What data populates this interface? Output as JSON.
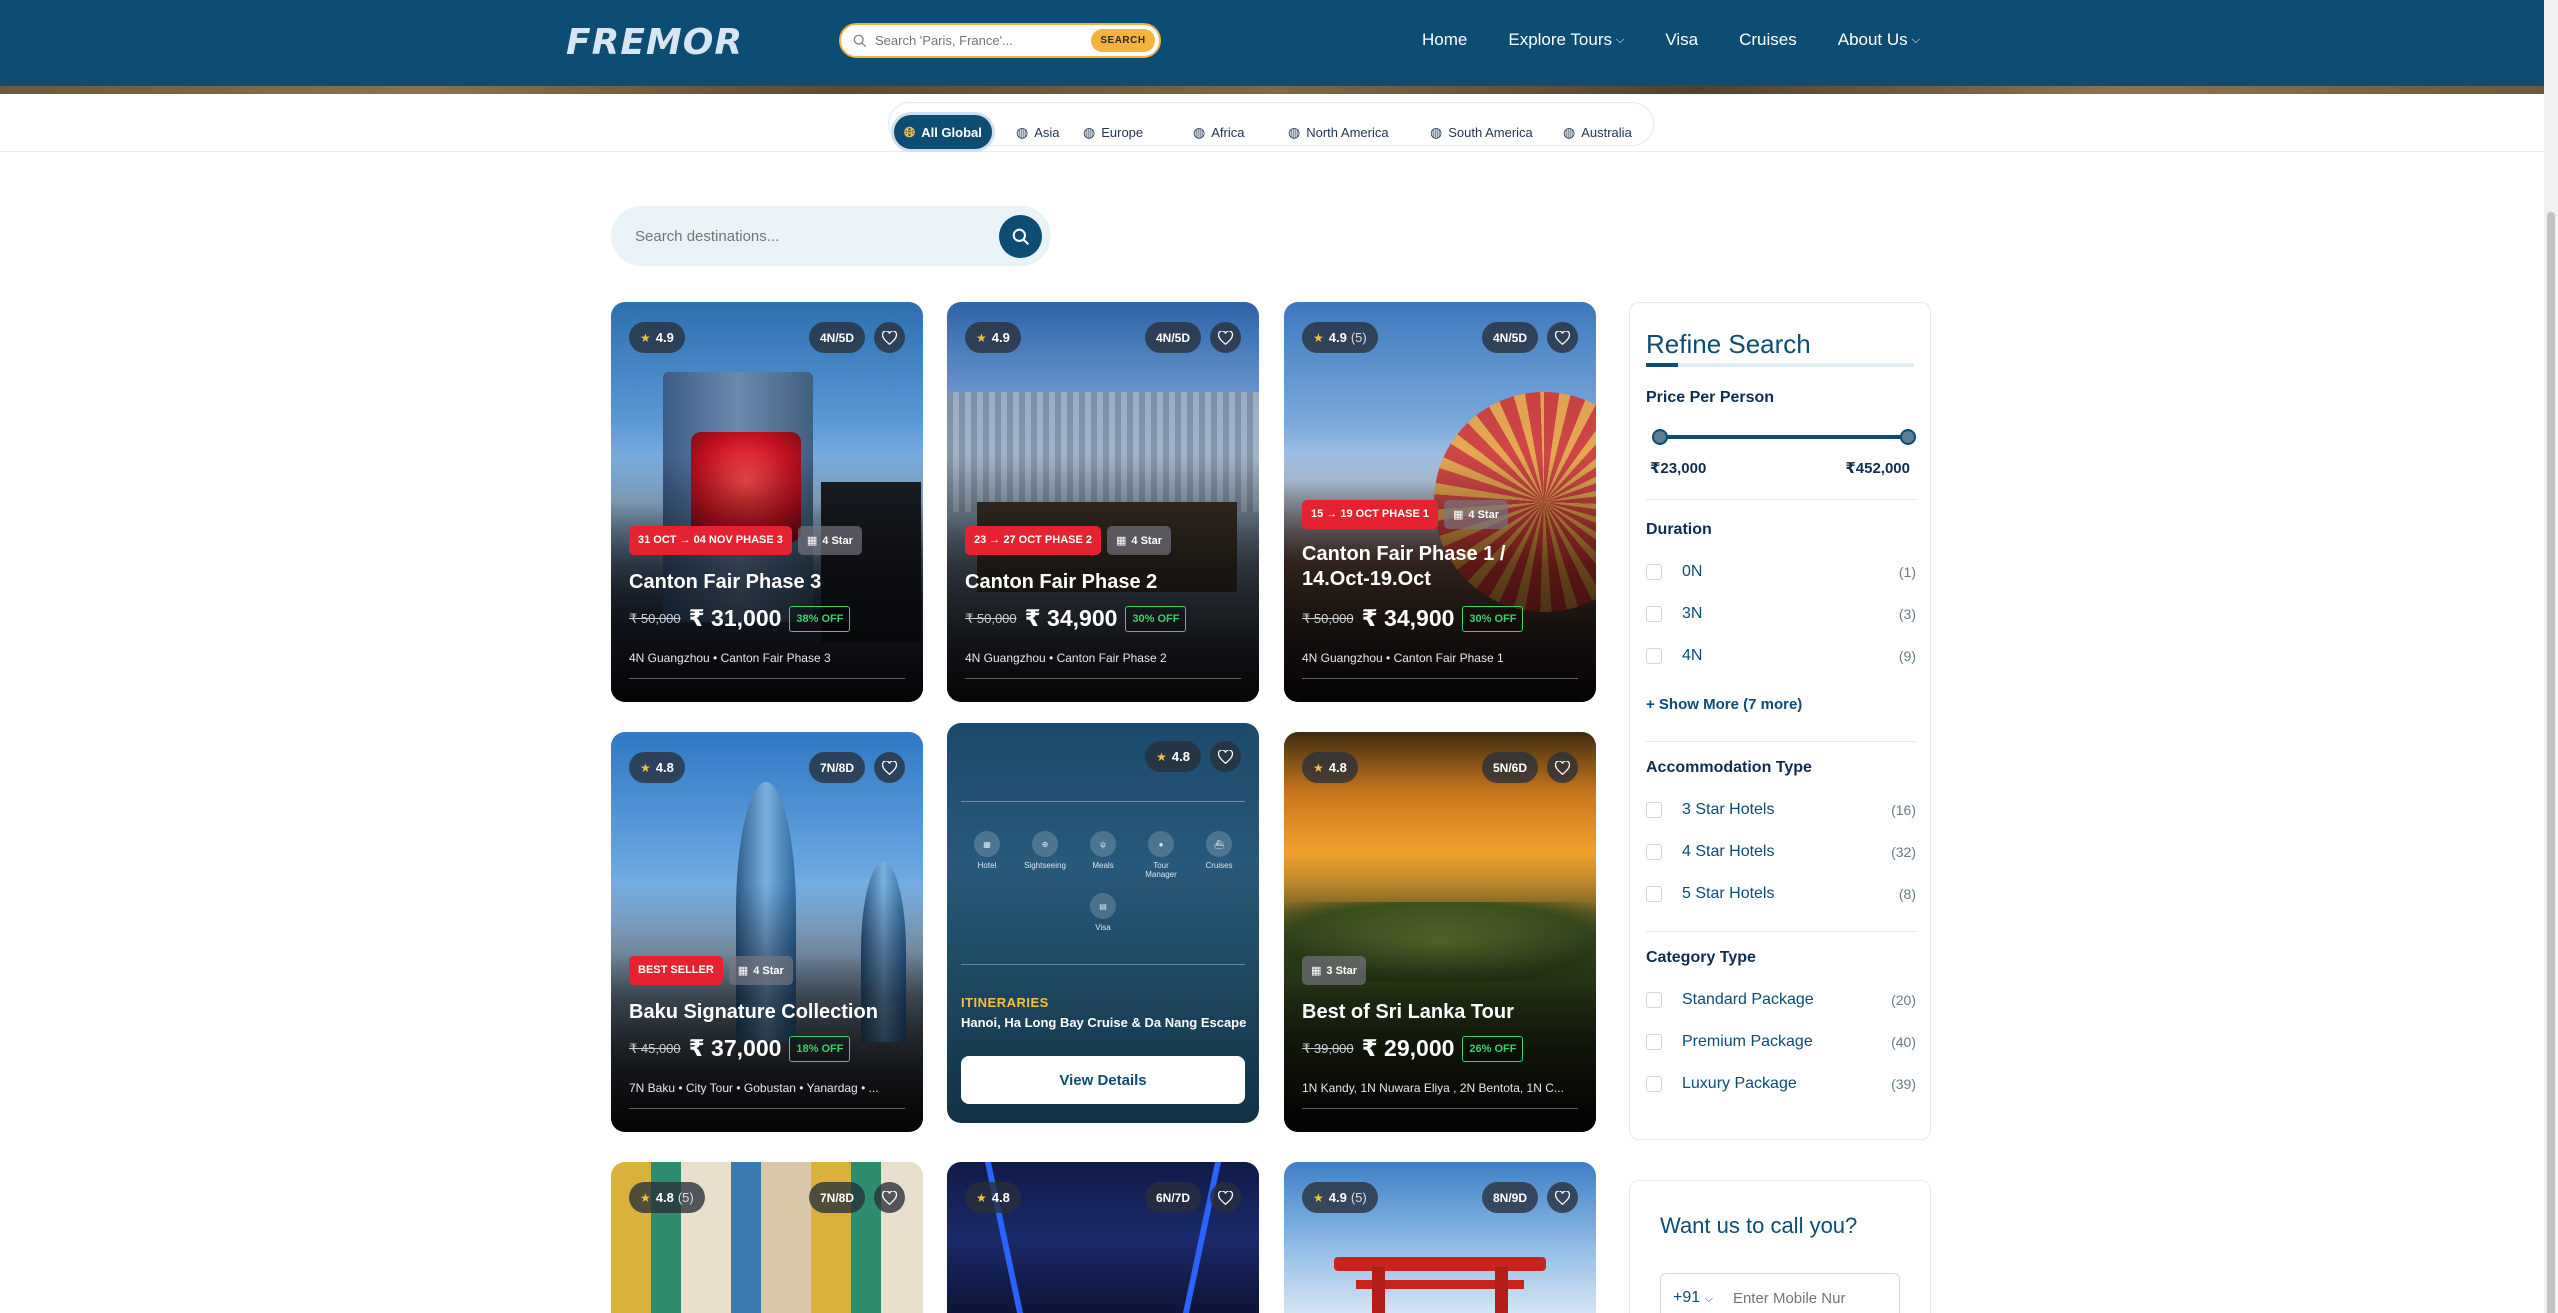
{
  "header": {
    "logo": "FREMOR",
    "search_placeholder": "Search 'Paris, France'...",
    "search_button": "SEARCH",
    "nav": [
      {
        "label": "Home"
      },
      {
        "label": "Explore Tours"
      },
      {
        "label": "Visa"
      },
      {
        "label": "Cruises"
      },
      {
        "label": "About Us"
      }
    ]
  },
  "regions": [
    "All Global",
    "Asia",
    "Europe",
    "Africa",
    "North America",
    "South America",
    "Australia"
  ],
  "destination_search_placeholder": "Search destinations...",
  "cards": [
    {
      "rating": "4.9",
      "reviews": "",
      "duration": "4N/5D",
      "tag": "31 OCT → 04 NOV PHASE 3",
      "hotel": "4 Star",
      "title": "Canton Fair Phase 3",
      "old_price": "₹ 50,000",
      "price": "₹ 31,000",
      "off": "38% OFF",
      "route": "4N Guangzhou • Canton Fair Phase 3"
    },
    {
      "rating": "4.9",
      "reviews": "",
      "duration": "4N/5D",
      "tag": "23 → 27 OCT PHASE 2",
      "hotel": "4 Star",
      "title": "Canton Fair Phase 2",
      "old_price": "₹ 50,000",
      "price": "₹ 34,900",
      "off": "30% OFF",
      "route": "4N Guangzhou • Canton Fair Phase 2"
    },
    {
      "rating": "4.9",
      "reviews": "(5)",
      "duration": "4N/5D",
      "tag": "15 → 19 OCT PHASE 1",
      "hotel": "4 Star",
      "title": "Canton Fair Phase 1 / 14.Oct-19.Oct",
      "old_price": "₹ 50,000",
      "price": "₹ 34,900",
      "off": "30% OFF",
      "route": "4N Guangzhou • Canton Fair Phase 1"
    },
    {
      "rating": "4.8",
      "reviews": "",
      "duration": "7N/8D",
      "tag": "BEST SELLER",
      "hotel": "4 Star",
      "title": "Baku Signature Collection",
      "old_price": "₹ 45,000",
      "price": "₹ 37,000",
      "off": "18% OFF",
      "route": "7N Baku • City Tour • Gobustan • Yanardag • ..."
    },
    {
      "rating": "4.8",
      "itinerary_label": "ITINERARIES",
      "itinerary": "Hanoi, Ha Long Bay Cruise & Da Nang Escape",
      "button": "View Details",
      "inclusions": [
        "Hotel",
        "Sightseeing",
        "Meals",
        "Tour Manager",
        "Cruises",
        "Visa"
      ]
    },
    {
      "rating": "4.8",
      "reviews": "",
      "duration": "5N/6D",
      "tag": "",
      "hotel": "3 Star",
      "title": "Best of Sri Lanka Tour",
      "old_price": "₹ 39,000",
      "price": "₹ 29,000",
      "off": "26% OFF",
      "route": "1N Kandy, 1N Nuwara Eliya , 2N Bentota, 1N C..."
    },
    {
      "rating": "4.8",
      "reviews": "(5)",
      "duration": "7N/8D"
    },
    {
      "rating": "4.8",
      "reviews": "",
      "duration": "6N/7D"
    },
    {
      "rating": "4.9",
      "reviews": "(5)",
      "duration": "8N/9D"
    }
  ],
  "refine": {
    "title": "Refine Search",
    "price_title": "Price Per Person",
    "price_min": "₹23,000",
    "price_max": "₹452,000",
    "duration_title": "Duration",
    "durations": [
      {
        "label": "0N",
        "count": "(1)"
      },
      {
        "label": "3N",
        "count": "(3)"
      },
      {
        "label": "4N",
        "count": "(9)"
      }
    ],
    "show_more": "+ Show More (7 more)",
    "accommodation_title": "Accommodation Type",
    "accommodations": [
      {
        "label": "3 Star Hotels",
        "count": "(16)"
      },
      {
        "label": "4 Star Hotels",
        "count": "(32)"
      },
      {
        "label": "5 Star Hotels",
        "count": "(8)"
      }
    ],
    "category_title": "Category Type",
    "categories": [
      {
        "label": "Standard Package",
        "count": "(20)"
      },
      {
        "label": "Premium Package",
        "count": "(40)"
      },
      {
        "label": "Luxury Package",
        "count": "(39)"
      }
    ]
  },
  "callback": {
    "title": "Want us to call you?",
    "country_code": "+91",
    "phone_placeholder": "Enter Mobile Nur"
  }
}
